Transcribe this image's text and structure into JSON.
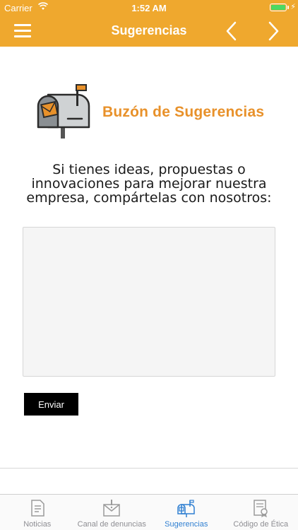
{
  "status_bar": {
    "carrier": "Carrier",
    "time": "1:52 AM",
    "charging_symbol": "⚡"
  },
  "nav": {
    "title": "Sugerencias",
    "menu_icon": "hamburger-menu-icon",
    "prev_icon": "chevron-left-icon",
    "next_icon": "chevron-right-icon",
    "bar_color": "#efa82e"
  },
  "banner": {
    "brand_text": "Buzón de Sugerencias",
    "brand_color": "#e8912a",
    "icon": "mailbox-icon"
  },
  "intro_text": "Si tienes ideas, propuestas o innovaciones para mejorar nuestra empresa, compártelas con nosotros:",
  "form": {
    "message_value": "",
    "send_label": "Enviar"
  },
  "tabs": [
    {
      "label": "Noticias",
      "icon": "newspaper-icon",
      "active": false
    },
    {
      "label": "Canal de denuncias",
      "icon": "alert-envelope-icon",
      "active": false
    },
    {
      "label": "Sugerencias",
      "icon": "mailbox-icon",
      "active": true
    },
    {
      "label": "Código de Ética",
      "icon": "document-seal-icon",
      "active": false
    }
  ],
  "colors": {
    "active_tab": "#2f7fd1",
    "inactive_tab": "#8e8e93"
  }
}
